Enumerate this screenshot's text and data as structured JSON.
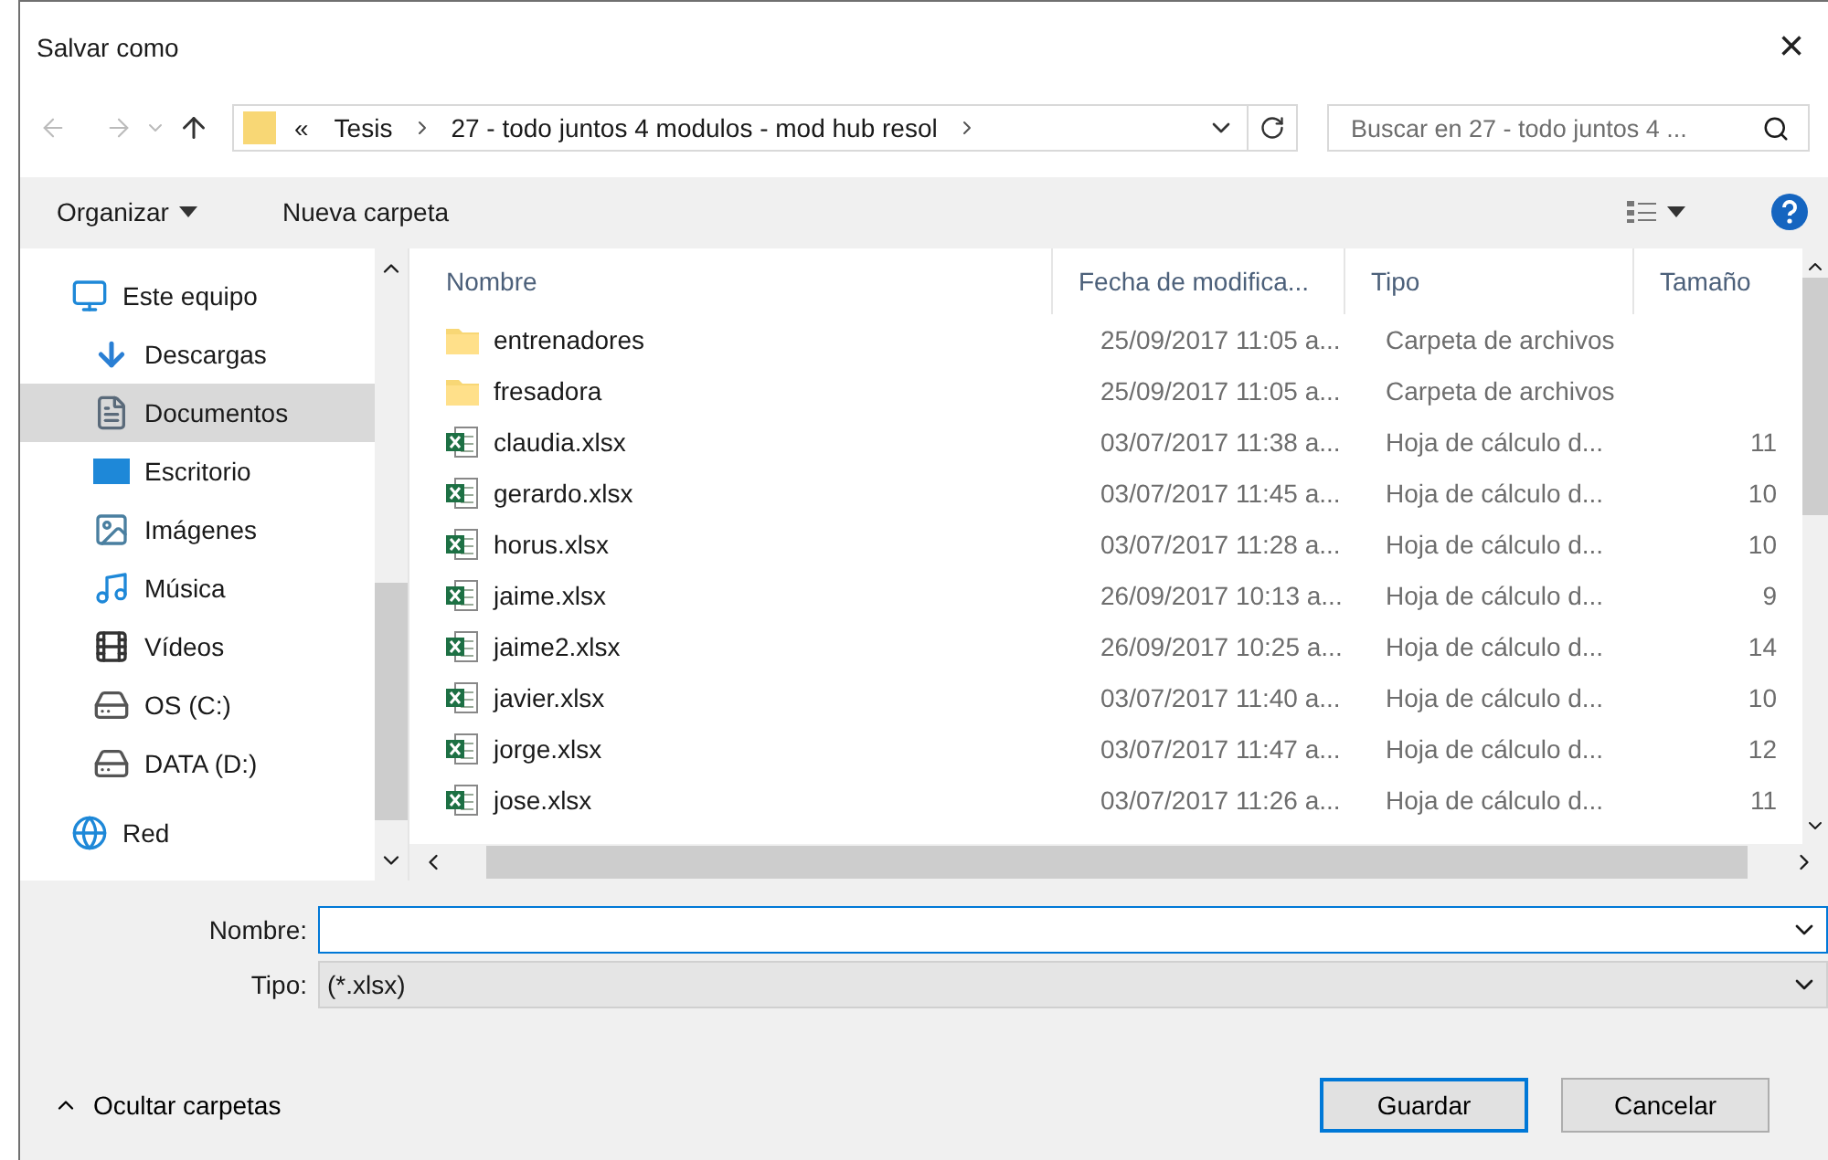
{
  "window": {
    "title": "Salvar como",
    "close": "×"
  },
  "address": {
    "overflow": "«",
    "crumbs": [
      "Tesis",
      "27 - todo juntos 4 modulos - mod hub resol"
    ],
    "search_placeholder": "Buscar en 27 - todo juntos 4 ..."
  },
  "toolbar": {
    "organize": "Organizar",
    "new_folder": "Nueva carpeta"
  },
  "sidebar": {
    "items": [
      {
        "label": "Este equipo",
        "kind": "computer",
        "selected": false,
        "children": [
          {
            "label": "Descargas",
            "kind": "downloads",
            "selected": false
          },
          {
            "label": "Documentos",
            "kind": "documents",
            "selected": true
          },
          {
            "label": "Escritorio",
            "kind": "desktop",
            "selected": false
          },
          {
            "label": "Imágenes",
            "kind": "pictures",
            "selected": false
          },
          {
            "label": "Música",
            "kind": "music",
            "selected": false
          },
          {
            "label": "Vídeos",
            "kind": "videos",
            "selected": false
          },
          {
            "label": "OS (C:)",
            "kind": "osdrive",
            "selected": false
          },
          {
            "label": "DATA (D:)",
            "kind": "drive",
            "selected": false
          }
        ]
      },
      {
        "label": "Red",
        "kind": "network",
        "selected": false
      }
    ]
  },
  "table": {
    "columns": [
      "Nombre",
      "Fecha de modifica...",
      "Tipo",
      "Tamaño"
    ],
    "rows": [
      {
        "kind": "folder",
        "name": "entrenadores",
        "date": "25/09/2017 11:05 a...",
        "type": "Carpeta de archivos"
      },
      {
        "kind": "folder",
        "name": "fresadora",
        "date": "25/09/2017 11:05 a...",
        "type": "Carpeta de archivos"
      },
      {
        "kind": "excel",
        "name": "claudia.xlsx",
        "date": "03/07/2017 11:38 a...",
        "type": "Hoja de cálculo d...",
        "size": "11"
      },
      {
        "kind": "excel",
        "name": "gerardo.xlsx",
        "date": "03/07/2017 11:45 a...",
        "type": "Hoja de cálculo d...",
        "size": "10"
      },
      {
        "kind": "excel",
        "name": "horus.xlsx",
        "date": "03/07/2017 11:28 a...",
        "type": "Hoja de cálculo d...",
        "size": "10"
      },
      {
        "kind": "excel",
        "name": "jaime.xlsx",
        "date": "26/09/2017 10:13 a...",
        "type": "Hoja de cálculo d...",
        "size": "9"
      },
      {
        "kind": "excel",
        "name": "jaime2.xlsx",
        "date": "26/09/2017 10:25 a...",
        "type": "Hoja de cálculo d...",
        "size": "14"
      },
      {
        "kind": "excel",
        "name": "javier.xlsx",
        "date": "03/07/2017 11:40 a...",
        "type": "Hoja de cálculo d...",
        "size": "10"
      },
      {
        "kind": "excel",
        "name": "jorge.xlsx",
        "date": "03/07/2017 11:47 a...",
        "type": "Hoja de cálculo d...",
        "size": "12"
      },
      {
        "kind": "excel",
        "name": "jose.xlsx",
        "date": "03/07/2017 11:26 a...",
        "type": "Hoja de cálculo d...",
        "size": "11"
      }
    ]
  },
  "form": {
    "name_label": "Nombre:",
    "type_label": "Tipo:",
    "type_value": "(*.xlsx)"
  },
  "footer": {
    "hide_folders": "Ocultar carpetas",
    "save": "Guardar",
    "cancel": "Cancelar"
  }
}
